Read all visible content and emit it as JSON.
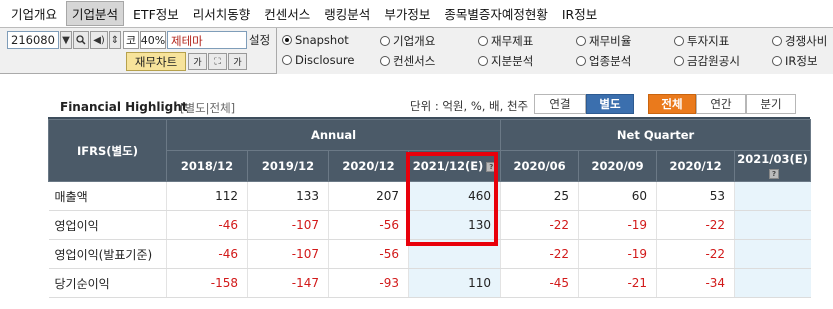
{
  "menu": {
    "items": [
      "기업개요",
      "기업분석",
      "ETF정보",
      "리서치동향",
      "컨센서스",
      "랭킹분석",
      "부가정보",
      "종목별증자예정현황",
      "IR정보"
    ],
    "active_index": 1
  },
  "toolbar": {
    "code_value": "216080",
    "ko_label": "코",
    "pct_label": "40%",
    "theme_value": "제테마",
    "setting_label": "설정",
    "chart_button": "재무차트",
    "ga_label_1": "가",
    "ga_label_2": "가"
  },
  "radio_options": [
    {
      "label": "Snapshot",
      "checked": true
    },
    {
      "label": "기업개요",
      "checked": false
    },
    {
      "label": "재무제표",
      "checked": false
    },
    {
      "label": "재무비율",
      "checked": false
    },
    {
      "label": "투자지표",
      "checked": false
    },
    {
      "label": "경쟁사비",
      "checked": false
    },
    {
      "label": "Disclosure",
      "checked": false
    },
    {
      "label": "컨센서스",
      "checked": false
    },
    {
      "label": "지분분석",
      "checked": false
    },
    {
      "label": "업종분석",
      "checked": false
    },
    {
      "label": "금감원공시",
      "checked": false
    },
    {
      "label": "IR정보",
      "checked": false
    }
  ],
  "highlight": {
    "title": "Financial Highlight",
    "subtitle": "[별도|전체]",
    "unit": "단위 : 억원, %, 배, 천주",
    "btn_consolidated": "연결",
    "btn_separate": "별도",
    "btn_all": "전체",
    "btn_annual": "연간",
    "btn_quarter": "분기"
  },
  "table": {
    "corner_label": "IFRS(별도)",
    "group_annual": "Annual",
    "group_quarter": "Net Quarter",
    "columns": [
      "2018/12",
      "2019/12",
      "2020/12",
      "2021/12(E)",
      "2020/06",
      "2020/09",
      "2020/12",
      "2021/03(E)"
    ],
    "rows": [
      {
        "label": "매출액",
        "values": [
          "112",
          "133",
          "207",
          "460",
          "25",
          "60",
          "53",
          ""
        ]
      },
      {
        "label": "영업이익",
        "values": [
          "-46",
          "-107",
          "-56",
          "130",
          "-22",
          "-19",
          "-22",
          ""
        ]
      },
      {
        "label": "영업이익(발표기준)",
        "values": [
          "-46",
          "-107",
          "-56",
          "",
          "-22",
          "-19",
          "-22",
          ""
        ]
      },
      {
        "label": "당기순이익",
        "values": [
          "-158",
          "-147",
          "-93",
          "110",
          "-45",
          "-21",
          "-34",
          ""
        ]
      }
    ]
  },
  "colors": {
    "header_bg": "#4b5a68",
    "negative": "#d21a1a",
    "estimate_bg": "#e8f4fb",
    "highlight_red": "#e8000b"
  }
}
